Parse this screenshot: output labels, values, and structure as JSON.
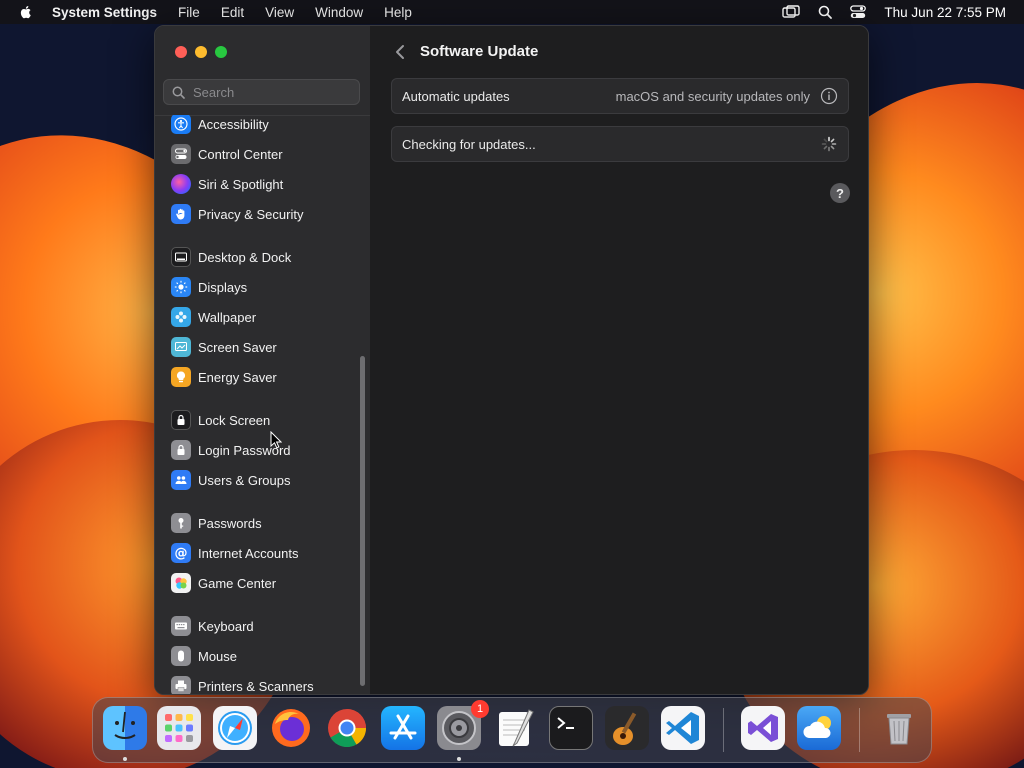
{
  "menubar": {
    "app_name": "System Settings",
    "menus": [
      "File",
      "Edit",
      "View",
      "Window",
      "Help"
    ],
    "clock": "Thu Jun 22  7:55 PM"
  },
  "sidebar": {
    "search_placeholder": "Search",
    "items": [
      {
        "label": "Accessibility",
        "icon": "accessibility-icon",
        "color": "#1a7cf5"
      },
      {
        "label": "Control Center",
        "icon": "control-center-icon",
        "color": "#6b6b6e"
      },
      {
        "label": "Siri & Spotlight",
        "icon": "siri-icon",
        "color": "#a03cd8"
      },
      {
        "label": "Privacy & Security",
        "icon": "hand-icon",
        "color": "#2f7bf5"
      },
      {
        "label": "Desktop & Dock",
        "icon": "dock-icon",
        "color": "#1c1c1e"
      },
      {
        "label": "Displays",
        "icon": "sun-icon",
        "color": "#2a86f5"
      },
      {
        "label": "Wallpaper",
        "icon": "wallpaper-icon",
        "color": "#35a7e8"
      },
      {
        "label": "Screen Saver",
        "icon": "screen-saver-icon",
        "color": "#4fb7d6"
      },
      {
        "label": "Energy Saver",
        "icon": "bulb-icon",
        "color": "#f5a623"
      },
      {
        "label": "Lock Screen",
        "icon": "lock-icon",
        "color": "#1c1c1e"
      },
      {
        "label": "Login Password",
        "icon": "lock-icon",
        "color": "#8e8e93"
      },
      {
        "label": "Users & Groups",
        "icon": "users-icon",
        "color": "#2f7bf5"
      },
      {
        "label": "Passwords",
        "icon": "key-icon",
        "color": "#8e8e93"
      },
      {
        "label": "Internet Accounts",
        "icon": "at-icon",
        "color": "#2f7bf5"
      },
      {
        "label": "Game Center",
        "icon": "game-center-icon",
        "color": "#ffffff"
      },
      {
        "label": "Keyboard",
        "icon": "keyboard-icon",
        "color": "#8e8e93"
      },
      {
        "label": "Mouse",
        "icon": "mouse-icon",
        "color": "#8e8e93"
      },
      {
        "label": "Printers & Scanners",
        "icon": "printer-icon",
        "color": "#8e8e93"
      }
    ]
  },
  "main": {
    "title": "Software Update",
    "auto_updates_label": "Automatic updates",
    "auto_updates_value": "macOS and security updates only",
    "checking_label": "Checking for updates...",
    "help_label": "?"
  },
  "dock": {
    "apps": [
      "Finder",
      "Launchpad",
      "Safari",
      "Firefox",
      "Chrome",
      "App Store",
      "System Settings",
      "TextEdit",
      "Terminal",
      "GarageBand",
      "VS Code",
      "Visual Studio",
      "Weather",
      "Trash"
    ],
    "system_settings_badge": "1"
  }
}
